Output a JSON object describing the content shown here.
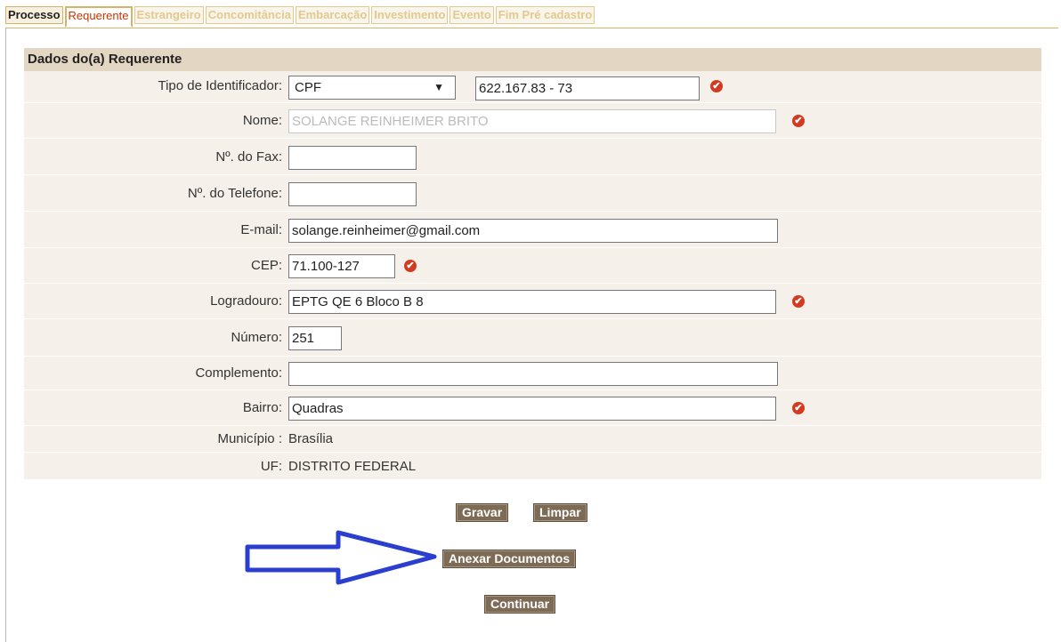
{
  "tabs": [
    {
      "label": "Processo"
    },
    {
      "label": "Requerente"
    },
    {
      "label": "Estrangeiro"
    },
    {
      "label": "Concomitância"
    },
    {
      "label": "Embarcação"
    },
    {
      "label": "Investimento"
    },
    {
      "label": "Evento"
    },
    {
      "label": "Fim Pré cadastro"
    }
  ],
  "panel": {
    "title": "Dados do(a) Requerente"
  },
  "form": {
    "tipo_identificador_label": "Tipo de Identificador:",
    "tipo_identificador_value": "CPF",
    "cpf_value": "622.167.83 - 73",
    "nome_label": "Nome:",
    "nome_value": "SOLANGE REINHEIMER BRITO",
    "fax_label": "Nº. do Fax:",
    "fax_value": "",
    "telefone_label": "Nº. do Telefone:",
    "telefone_value": "",
    "email_label": "E-mail:",
    "email_value": "solange.reinheimer@gmail.com",
    "cep_label": "CEP:",
    "cep_value": "71.100-127",
    "logradouro_label": "Logradouro:",
    "logradouro_value": "EPTG QE 6 Bloco B 8",
    "numero_label": "Número:",
    "numero_value": "251",
    "complemento_label": "Complemento:",
    "complemento_value": "",
    "bairro_label": "Bairro:",
    "bairro_value": "Quadras",
    "municipio_label": "Município :",
    "municipio_value": "Brasília",
    "uf_label": "UF:",
    "uf_value": "DISTRITO FEDERAL"
  },
  "buttons": {
    "gravar": "Gravar",
    "limpar": "Limpar",
    "anexar": "Anexar Documentos",
    "continuar": "Continuar"
  },
  "icons": {
    "required": "required-check-icon",
    "arrow": "blue-arrow-annotation"
  },
  "colors": {
    "accent": "#d7b26a",
    "button": "#7d6b55",
    "required": "#d23b22",
    "arrow": "#2a3fd0"
  }
}
